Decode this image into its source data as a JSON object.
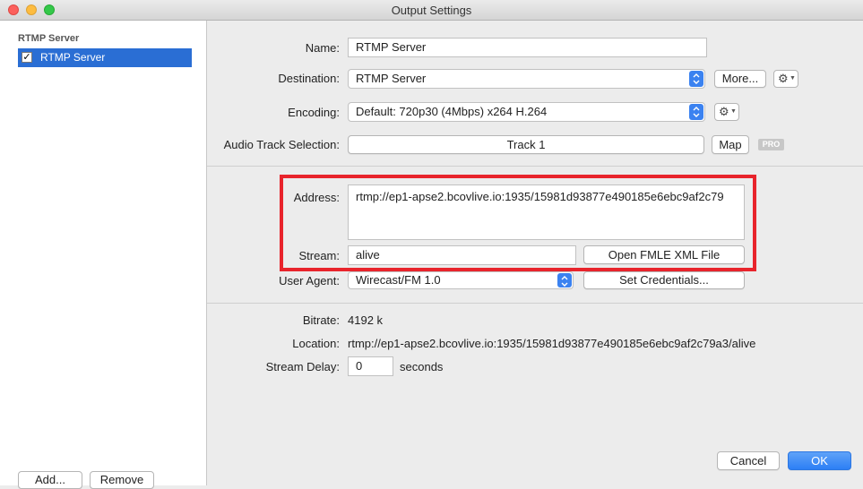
{
  "window": {
    "title": "Output Settings"
  },
  "sidebar": {
    "header": "RTMP Server",
    "items": [
      {
        "label": "RTMP Server",
        "checked": true
      }
    ],
    "add_label": "Add...",
    "remove_label": "Remove"
  },
  "form": {
    "name": {
      "label": "Name:",
      "value": "RTMP Server"
    },
    "destination": {
      "label": "Destination:",
      "value": "RTMP Server",
      "more_label": "More..."
    },
    "encoding": {
      "label": "Encoding:",
      "value": "Default: 720p30 (4Mbps) x264 H.264"
    },
    "audio": {
      "label": "Audio Track Selection:",
      "value": "Track 1",
      "map_label": "Map",
      "badge": "PRO"
    },
    "address": {
      "label": "Address:",
      "value": "rtmp://ep1-apse2.bcovlive.io:1935/15981d93877e490185e6ebc9af2c79"
    },
    "stream": {
      "label": "Stream:",
      "value": "alive",
      "open_label": "Open FMLE XML File"
    },
    "user_agent": {
      "label": "User Agent:",
      "value": "Wirecast/FM 1.0",
      "credentials_label": "Set Credentials..."
    }
  },
  "info": {
    "bitrate": {
      "label": "Bitrate:",
      "value": "4192 k"
    },
    "location": {
      "label": "Location:",
      "value": "rtmp://ep1-apse2.bcovlive.io:1935/15981d93877e490185e6ebc9af2c79a3/alive"
    },
    "delay": {
      "label": "Stream Delay:",
      "value": "0",
      "unit": "seconds"
    }
  },
  "footer": {
    "cancel_label": "Cancel",
    "ok_label": "OK"
  },
  "colors": {
    "accent": "#2a6ed4",
    "highlight": "#e8242c",
    "primary_button": "#2c7ff5"
  }
}
